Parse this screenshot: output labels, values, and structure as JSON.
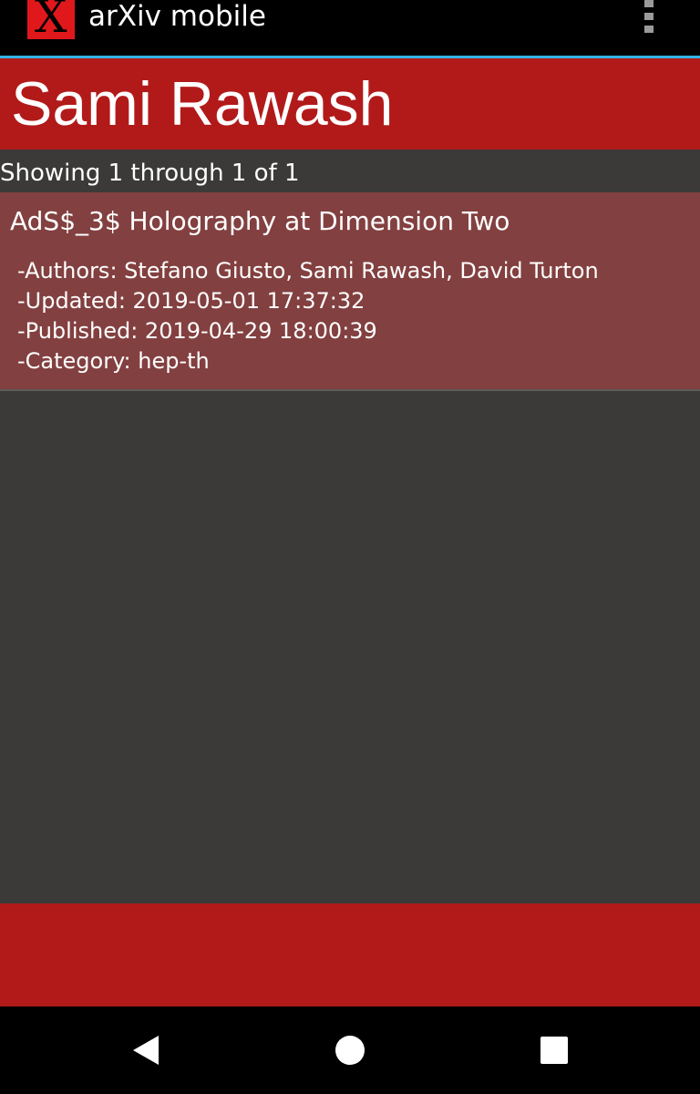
{
  "app": {
    "title": "arXiv mobile",
    "logo_letter": "X",
    "overflow_icon": "overflow-menu-icon"
  },
  "header": {
    "title": "Sami Rawash"
  },
  "results": {
    "summary": "Showing 1 through 1 of 1",
    "items": [
      {
        "title": "AdS$_3$ Holography at Dimension Two",
        "authors": "-Authors: Stefano Giusto, Sami Rawash, David Turton",
        "updated": "-Updated: 2019-05-01 17:37:32",
        "published": "-Published: 2019-04-29 18:00:39",
        "category": "-Category: hep-th"
      }
    ]
  },
  "navigation": {
    "back_icon": "back-icon",
    "home_icon": "home-icon",
    "recents_icon": "recents-icon"
  },
  "colors": {
    "actionbar": "#000000",
    "accent_line": "#33b5e5",
    "brand_red": "#b21a1a",
    "item_background": "#834040",
    "page_background": "#3b3a39"
  }
}
